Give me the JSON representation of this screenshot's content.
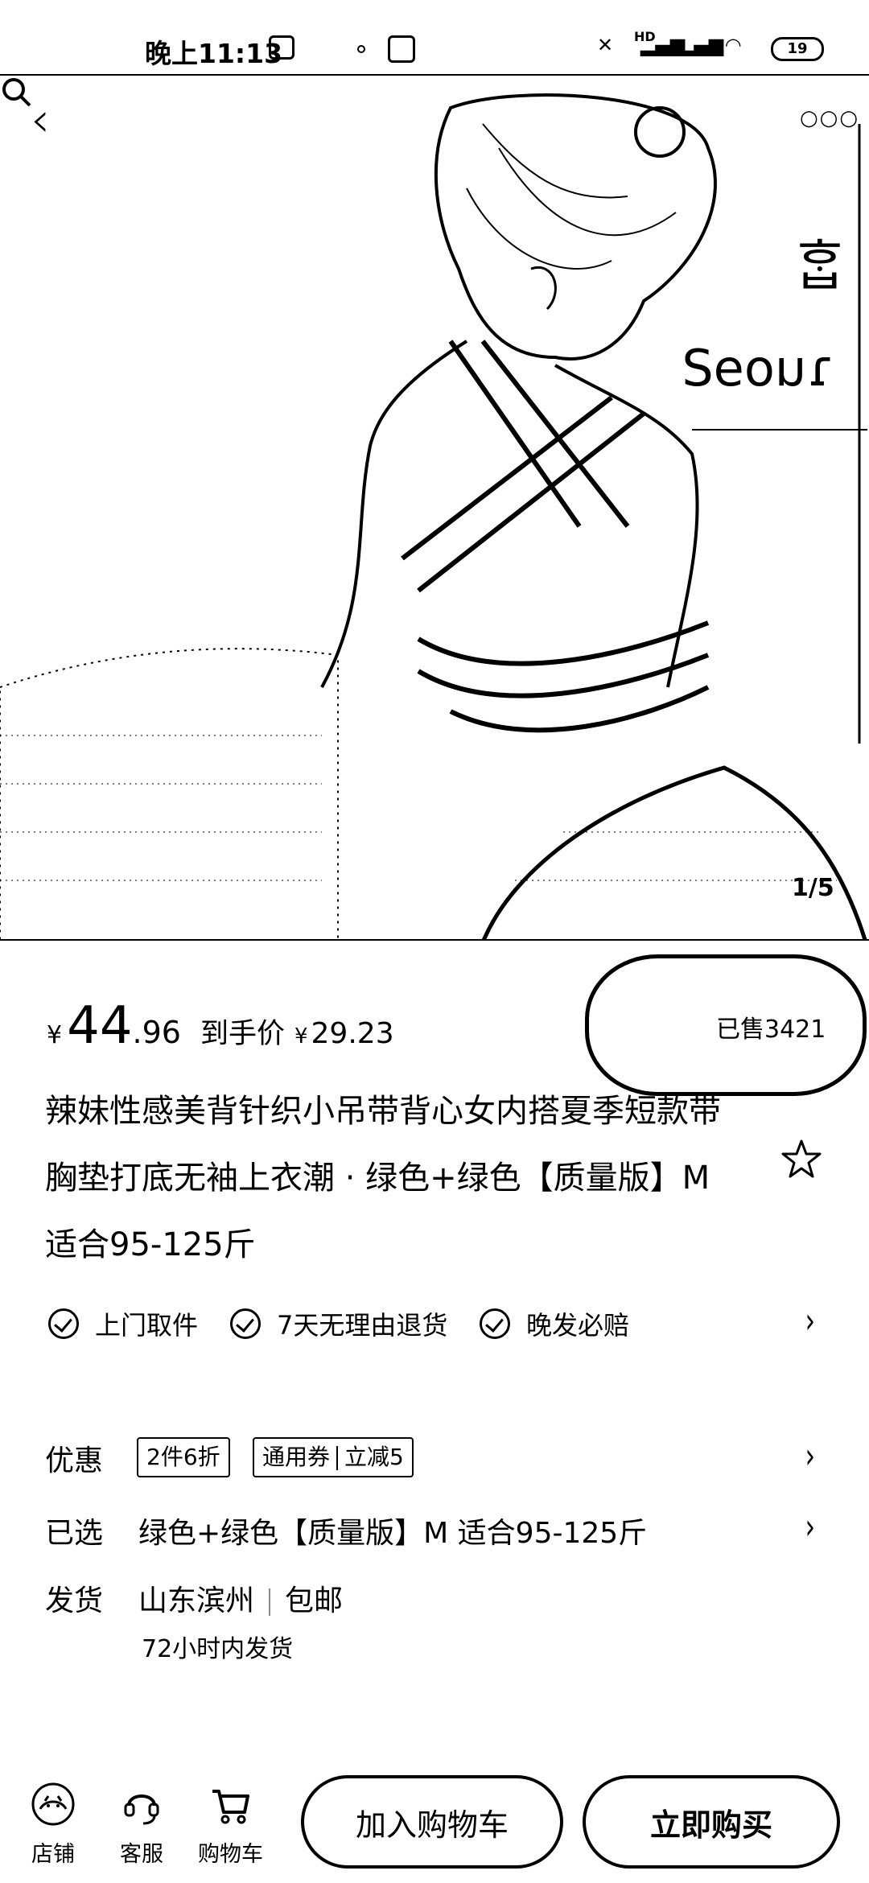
{
  "status_bar": {
    "time": "晚上11:13",
    "network": "HD",
    "battery": "19"
  },
  "product_image": {
    "counter": "1/5"
  },
  "price": {
    "currency": "¥",
    "integer": "44",
    "decimal": ".96",
    "net_label": "到手价",
    "net_currency": "¥",
    "net_value": "29.23",
    "sold": "已售3421"
  },
  "title": "辣妹性感美背针织小吊带背心女内搭夏季短款带胸垫打底无袖上衣潮 · 绿色+绿色【质量版】M 适合95-125斤",
  "guarantees": [
    {
      "label": "上门取件"
    },
    {
      "label": "7天无理由退货"
    },
    {
      "label": "晚发必赔"
    }
  ],
  "promo": {
    "label": "优惠",
    "tag1": "2件6折",
    "tag2_a": "通用券",
    "tag2_b": "立减5"
  },
  "selected": {
    "label": "已选",
    "value": "绿色+绿色【质量版】M 适合95-125斤"
  },
  "shipping": {
    "label": "发货",
    "origin": "山东滨州",
    "fee": "包邮",
    "time": "72小时内发货"
  },
  "bottom_bar": {
    "shop": "店铺",
    "service": "客服",
    "cart": "购物车",
    "add_to_cart": "加入购物车",
    "buy_now": "立即购买"
  }
}
